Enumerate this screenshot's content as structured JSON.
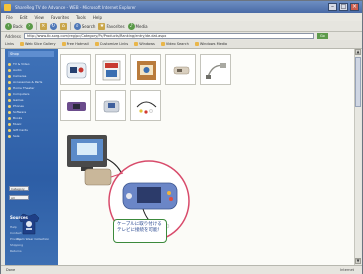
{
  "window": {
    "title": "ShareReg TV de Advance - WEB - Microsoft Internet Explorer",
    "controls": [
      "minimize-icon",
      "maximize-icon",
      "close-icon"
    ]
  },
  "menubar": [
    "File",
    "Edit",
    "View",
    "Favorites",
    "Tools",
    "Help"
  ],
  "toolbar": {
    "back_label": "Back",
    "forward_label": "",
    "refresh_label": "",
    "home_label": "",
    "search_label": "Search",
    "favorites_label": "Favorites",
    "media_label": "Media"
  },
  "address": {
    "label": "Address",
    "value": "http://www.tb.sorg.com/reg/pc/Category/Pc/Products/Ranking/entry/de.dat.aspx",
    "go_label": "Go"
  },
  "links": [
    "Links",
    "Web Slice Gallery",
    "Free Hotmail",
    "Customize Links",
    "Windows",
    "Video Search",
    "Windows Media"
  ],
  "sidebar": {
    "logo_text": "Shop",
    "items": [
      "TV & Video",
      "Audio",
      "Cameras",
      "Accessories & Parts",
      "Home Theater",
      "Computers",
      "Games",
      "Phones",
      "Software",
      "Books",
      "Music",
      "Gift Cards",
      "Sale"
    ],
    "select_1": "Category",
    "select_2": "All",
    "tshirt_caption": "Team Wear Collection",
    "section_title": "Sources",
    "footer_items": [
      "Help",
      "Contact",
      "Privacy",
      "Shipping",
      "Returns"
    ]
  },
  "status": {
    "text": "Done",
    "zone": "Internet"
  },
  "callout": {
    "text": "ケーブルに取り付けるテレビに接続を可能！"
  },
  "colors": {
    "titlebar": "#4a6aa6",
    "sidebar": "#2d5ea6",
    "content_bg": "#fbfbf7",
    "callout_border": "#3c8a3c",
    "callout_text": "#1d3e8a"
  }
}
